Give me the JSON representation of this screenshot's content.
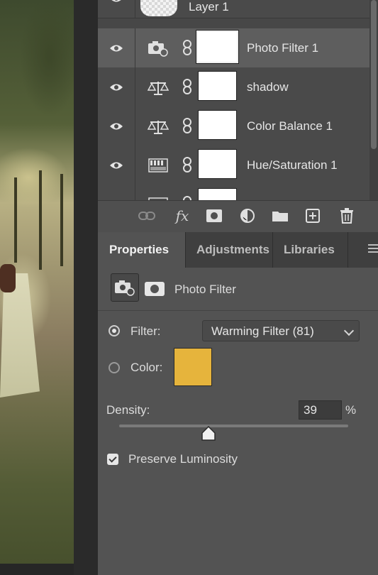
{
  "layers": [
    {
      "name": "Layer 1",
      "type": "pixel",
      "selected": false
    },
    {
      "name": "Photo Filter 1",
      "type": "photo-filter",
      "selected": true
    },
    {
      "name": "shadow",
      "type": "color-balance",
      "selected": false
    },
    {
      "name": "Color Balance 1",
      "type": "color-balance",
      "selected": false
    },
    {
      "name": "Hue/Saturation 1",
      "type": "hue-saturation",
      "selected": false
    },
    {
      "name": "",
      "type": "levels",
      "selected": false
    }
  ],
  "layer_toolbar": {
    "icons": [
      "link-icon",
      "fx-icon",
      "add-mask-icon",
      "adjustment-layer-icon",
      "folder-icon",
      "new-layer-icon",
      "trash-icon"
    ],
    "fx_label": "fx"
  },
  "tabs": [
    {
      "label": "Properties",
      "active": true
    },
    {
      "label": "Adjustments",
      "active": false
    },
    {
      "label": "Libraries",
      "active": false
    }
  ],
  "properties": {
    "title": "Photo Filter",
    "filter_label": "Filter:",
    "filter_value": "Warming Filter (81)",
    "filter_selected": true,
    "color_label": "Color:",
    "color_value": "#e6b43c",
    "density_label": "Density:",
    "density_value": "39",
    "density_unit": "%",
    "density_fraction": 0.39,
    "preserve_luminosity_label": "Preserve Luminosity",
    "preserve_luminosity_checked": true
  }
}
